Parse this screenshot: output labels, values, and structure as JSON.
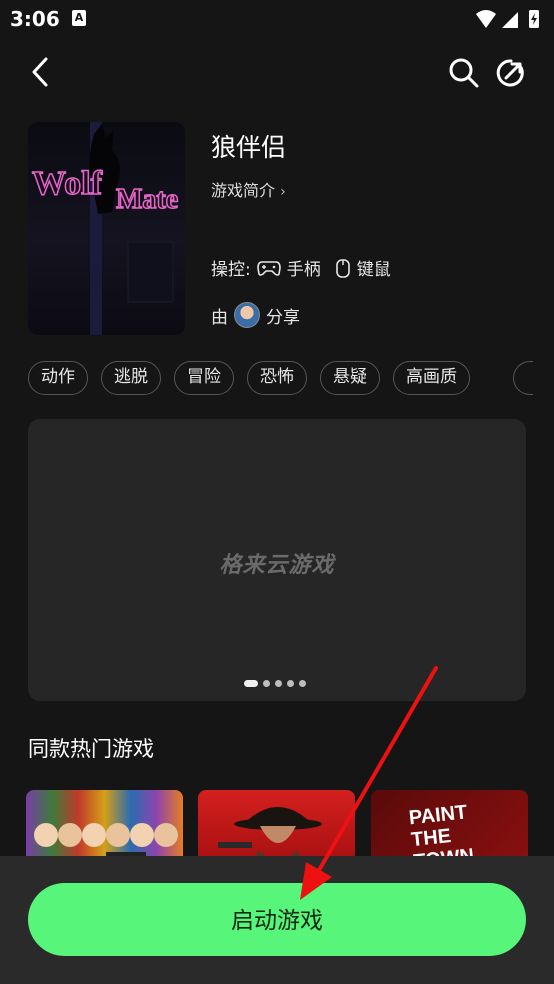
{
  "status_bar": {
    "time": "3:06",
    "notification_glyph": "A"
  },
  "header": {
    "back_icon": "chevron-left-icon",
    "search_icon": "search-icon",
    "share_icon": "share-arrow-icon"
  },
  "game": {
    "cover_text": "Wolf Mate",
    "title": "狼伴侣",
    "intro_label": "游戏简介",
    "intro_chevron": "›",
    "controls_label": "操控:",
    "control_gamepad": "手柄",
    "control_mouse": "键鼠",
    "shared_by_prefix": "由",
    "shared_by_suffix": "分享"
  },
  "tags": [
    "动作",
    "逃脱",
    "冒险",
    "恐怖",
    "悬疑",
    "高画质"
  ],
  "media": {
    "watermark": "格来云游戏",
    "slide_count": 5,
    "active_slide": 1
  },
  "similar": {
    "title": "同款热门游戏",
    "games": [
      {
        "name": "thumb-1"
      },
      {
        "name": "thumb-2"
      },
      {
        "name": "thumb-3",
        "text": "PAINT THE TOWN"
      }
    ]
  },
  "bottom": {
    "launch_label": "启动游戏"
  },
  "colors": {
    "accent": "#57f579",
    "background": "#151515",
    "annotation_arrow": "#ee1111"
  }
}
